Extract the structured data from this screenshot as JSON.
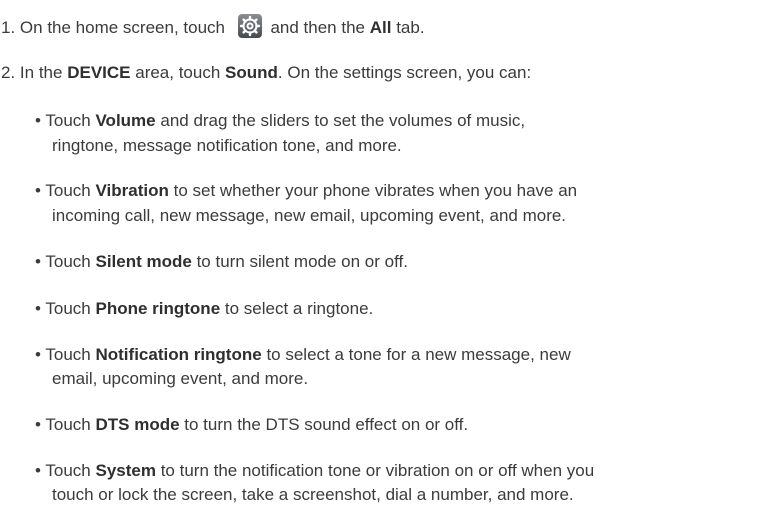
{
  "steps": [
    {
      "number": "1.",
      "pre": "On the home screen, touch",
      "icon": "settings-gear-icon",
      "mid": "and then the",
      "bold": "All",
      "post": "tab."
    },
    {
      "number": "2.",
      "pre": "In the",
      "bold1": "DEVICE",
      "mid": "area, touch",
      "bold2": "Sound",
      "post": ". On the settings screen, you can:"
    }
  ],
  "bullets": [
    {
      "pre": "Touch",
      "bold": "Volume",
      "line1": "and drag the sliders to set the volumes of music,",
      "line2": "ringtone, message notification tone, and more."
    },
    {
      "pre": "Touch",
      "bold": "Vibration",
      "line1": "to set whether your phone vibrates when you have an",
      "line2": "incoming call, new message, new email, upcoming event, and more."
    },
    {
      "pre": "Touch",
      "bold": "Silent mode",
      "line1": "to turn silent mode on or off."
    },
    {
      "pre": "Touch",
      "bold": "Phone ringtone",
      "line1": "to select a ringtone."
    },
    {
      "pre": "Touch",
      "bold": "Notification ringtone",
      "line1": "to select a tone for a new message, new",
      "line2": "email, upcoming event, and more."
    },
    {
      "pre": "Touch",
      "bold": "DTS mode",
      "line1": "to turn the DTS sound effect on or off."
    },
    {
      "pre": "Touch",
      "bold": "System",
      "line1": "to turn the notification tone or vibration on or off when you",
      "line2": "touch or lock the screen, take a screenshot, dial a number, and more."
    }
  ]
}
